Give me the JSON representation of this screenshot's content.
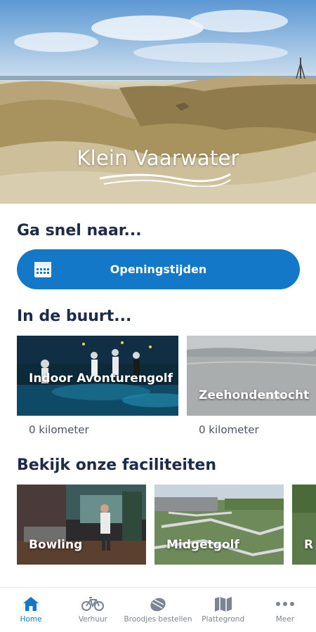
{
  "hero": {
    "logo_text": "Klein Vaarwater"
  },
  "quick": {
    "title": "Ga snel naar...",
    "button_label": "Openingstijden",
    "button_icon": "calendar-icon"
  },
  "nearby": {
    "title": "In de buurt...",
    "items": [
      {
        "title": "Indoor Avonturengolf",
        "distance": "0 kilometer"
      },
      {
        "title": "Zeehondentocht",
        "distance": "0 kilometer"
      }
    ]
  },
  "facilities": {
    "title": "Bekijk onze faciliteiten",
    "items": [
      {
        "title": "Bowling"
      },
      {
        "title": "Midgetgolf"
      },
      {
        "title": "R"
      }
    ]
  },
  "bottom_nav": {
    "items": [
      {
        "label": "Home",
        "icon": "home-icon",
        "active": true
      },
      {
        "label": "Verhuur",
        "icon": "bicycle-icon",
        "active": false
      },
      {
        "label": "Broodjes bestellen",
        "icon": "food-icon",
        "active": false
      },
      {
        "label": "Plattegrond",
        "icon": "map-icon",
        "active": false
      },
      {
        "label": "Meer",
        "icon": "more-icon",
        "active": false
      }
    ]
  },
  "colors": {
    "primary": "#1478c8",
    "heading": "#1d2b4a",
    "muted": "#7c8491"
  }
}
